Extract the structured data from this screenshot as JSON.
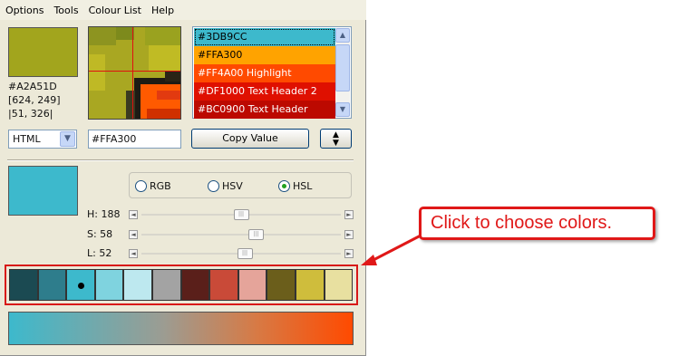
{
  "menubar": {
    "items": [
      "Options",
      "Tools",
      "Colour List",
      "Help"
    ]
  },
  "picker": {
    "current_color": "#A2A51D",
    "hex_label": "#A2A51D",
    "coord1": "[624, 249]",
    "coord2": "|51, 326|"
  },
  "colour_list": {
    "items": [
      {
        "label": "#3DB9CC",
        "color": "#3DB9CC",
        "text_color": "#000000",
        "selected": true
      },
      {
        "label": "#FFA300",
        "color": "#FFA300",
        "text_color": "#000000"
      },
      {
        "label": "#FF4A00 Highlight",
        "color": "#FF4A00",
        "text_color": "#ffffff"
      },
      {
        "label": "#DF1000 Text Header 2",
        "color": "#DF1000",
        "text_color": "#ffffff"
      },
      {
        "label": "#BC0900 Text Header",
        "color": "#BC0900",
        "text_color": "#ffffff"
      }
    ]
  },
  "format": {
    "selected": "HTML",
    "value": "#FFA300",
    "copy_label": "Copy Value"
  },
  "mode": {
    "options": [
      "RGB",
      "HSV",
      "HSL"
    ],
    "selected": "HSL"
  },
  "sliders": [
    {
      "label": "H: 188",
      "fraction": 0.5
    },
    {
      "label": "S: 58",
      "fraction": 0.58
    },
    {
      "label": "L: 52",
      "fraction": 0.52
    }
  ],
  "palette": {
    "colors": [
      "#1b4a52",
      "#2e7d8c",
      "#3DB9CC",
      "#7fd3df",
      "#bde8ef",
      "#a3a3a3",
      "#5a1f1a",
      "#c94a38",
      "#e5a49a",
      "#6b5e1b",
      "#cfbd3c",
      "#e8e0a0"
    ],
    "selected_index": 2
  },
  "gradient": {
    "start": "#3DB9CC",
    "end": "#FF4A00"
  },
  "callout": {
    "text": "Click to choose colors.",
    "color": "#e01818"
  }
}
